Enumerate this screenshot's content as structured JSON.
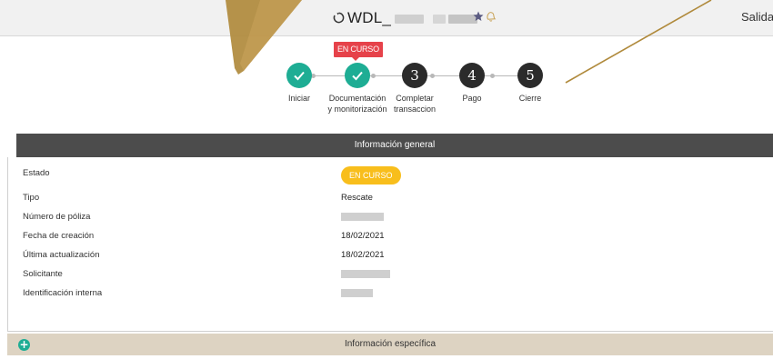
{
  "header": {
    "title_prefix": "WDL_",
    "right_link": "Salidas"
  },
  "status_tag": "EN CURSO",
  "steps": [
    {
      "label": "Iniciar",
      "state": "done"
    },
    {
      "label": "Documentación y monitorización",
      "state": "done"
    },
    {
      "number": "3",
      "label": "Completar transaccion",
      "state": "pending"
    },
    {
      "number": "4",
      "label": "Pago",
      "state": "pending"
    },
    {
      "number": "5",
      "label": "Cierre",
      "state": "pending"
    }
  ],
  "info_general": {
    "title": "Información general",
    "rows": {
      "estado": {
        "label": "Estado",
        "value": "EN CURSO"
      },
      "tipo": {
        "label": "Tipo",
        "value": "Rescate"
      },
      "poliza": {
        "label": "Número de póliza"
      },
      "creacion": {
        "label": "Fecha de creación",
        "value": "18/02/2021"
      },
      "actualizacion": {
        "label": "Última actualización",
        "value": "18/02/2021"
      },
      "solicitante": {
        "label": "Solicitante"
      },
      "identificacion": {
        "label": "Identificación interna"
      }
    }
  },
  "info_especifica": {
    "title": "Información específica"
  },
  "colors": {
    "done": "#1ead94",
    "pending": "#2b2b2b",
    "status_tag": "#e6424a",
    "badge": "#f8be1c",
    "section_header": "#4c4c4c",
    "specific_bar": "#ddd3c2"
  },
  "icons": [
    "refresh-icon",
    "star-icon",
    "bell-icon",
    "check-icon",
    "plus-icon"
  ]
}
